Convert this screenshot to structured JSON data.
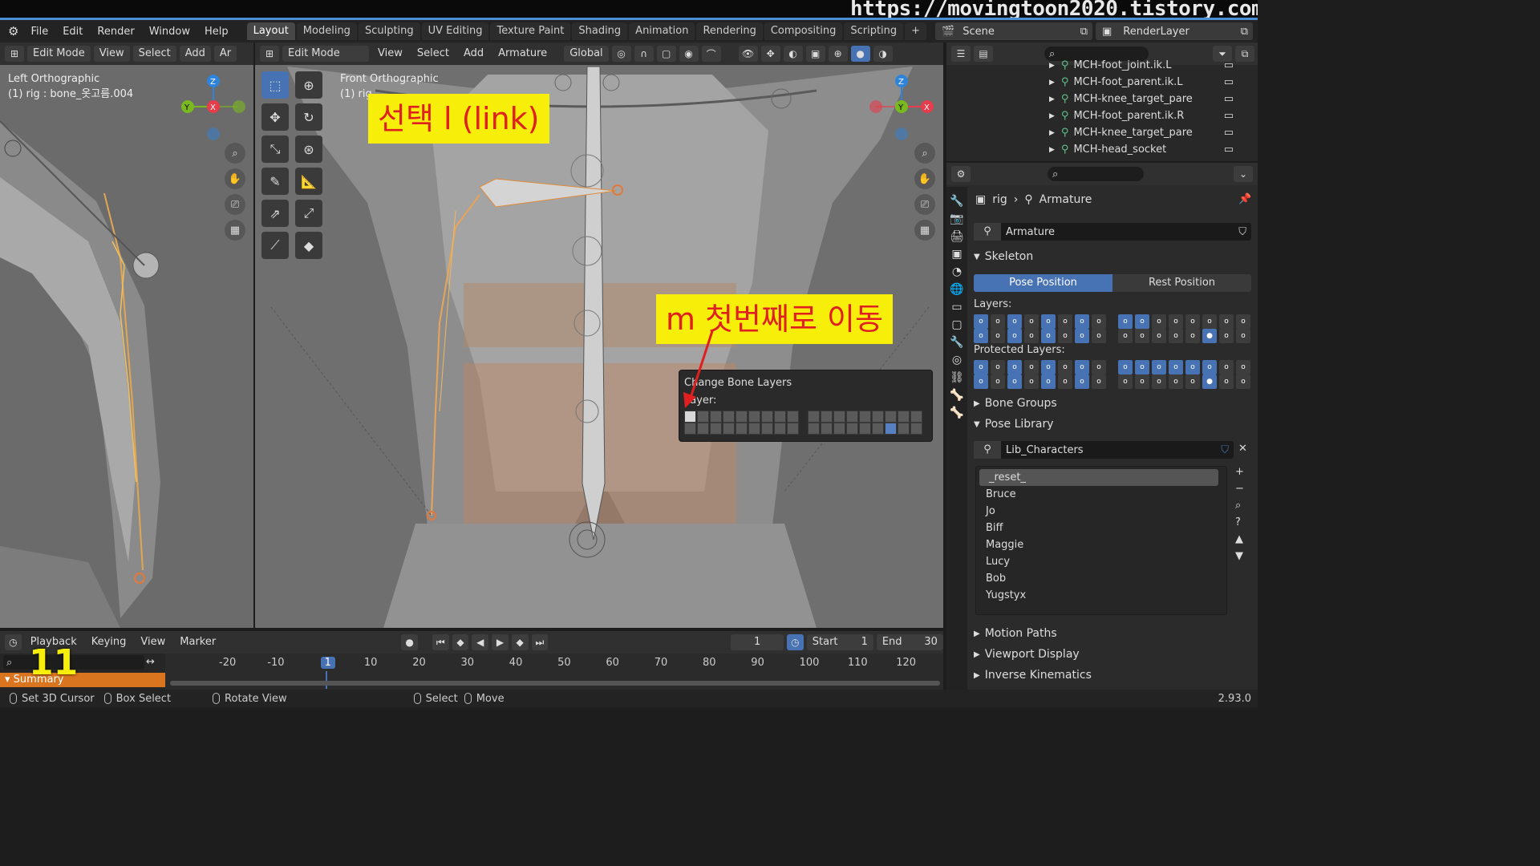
{
  "watermark": "https://movingtoon2020.tistory.com",
  "menu": [
    "File",
    "Edit",
    "Render",
    "Window",
    "Help"
  ],
  "workspaces": [
    {
      "label": "Layout",
      "active": true
    },
    {
      "label": "Modeling"
    },
    {
      "label": "Sculpting"
    },
    {
      "label": "UV Editing"
    },
    {
      "label": "Texture Paint"
    },
    {
      "label": "Shading"
    },
    {
      "label": "Animation"
    },
    {
      "label": "Rendering"
    },
    {
      "label": "Compositing"
    },
    {
      "label": "Scripting"
    }
  ],
  "add_workspace": "+",
  "scene": {
    "label": "Scene",
    "layer": "RenderLayer"
  },
  "left_vp": {
    "mode": "Edit Mode",
    "view": "View",
    "select": "Select",
    "add": "Add",
    "more": "Ar",
    "title": "Left Orthographic",
    "subtitle": "(1) rig : bone_옷고름.004"
  },
  "main_vp": {
    "mode": "Edit Mode",
    "view": "View",
    "select": "Select",
    "add": "Add",
    "armature": "Armature",
    "orientation": "Global",
    "title": "Front Orthographic",
    "subtitle": "(1) rig"
  },
  "axes": {
    "x": "X",
    "y": "Y",
    "z": "Z"
  },
  "annotations": {
    "select_link": "선택 l (link)",
    "move_first": "m 첫번째로 이동"
  },
  "popup": {
    "title": "Change Bone Layers",
    "layer": "Layer:"
  },
  "outliner": {
    "items": [
      "MCH-foot_joint.ik.L",
      "MCH-foot_parent.ik.L",
      "MCH-knee_target_pare",
      "MCH-foot_parent.ik.R",
      "MCH-knee_target_pare",
      "MCH-head_socket"
    ]
  },
  "properties": {
    "breadcrumb": [
      "rig",
      "Armature"
    ],
    "data_name": "Armature",
    "skeleton": "Skeleton",
    "pose_position": "Pose Position",
    "rest_position": "Rest Position",
    "layers": "Layers:",
    "protected_layers": "Protected Layers:",
    "bone_groups": "Bone Groups",
    "pose_library": "Pose Library",
    "library_name": "Lib_Characters",
    "poses": [
      "_reset_",
      "Bruce",
      "Jo",
      "Biff",
      "Maggie",
      "Lucy",
      "Bob",
      "Yugstyx"
    ],
    "motion_paths": "Motion Paths",
    "viewport_display": "Viewport Display",
    "inverse_kinematics": "Inverse Kinematics"
  },
  "timeline": {
    "playback": "Playback",
    "keying": "Keying",
    "view": "View",
    "marker": "Marker",
    "current_frame": "1",
    "start_label": "Start",
    "start": "1",
    "end_label": "End",
    "end": "30",
    "ticks": [
      "-20",
      "-10",
      "1",
      "10",
      "20",
      "30",
      "40",
      "50",
      "60",
      "70",
      "80",
      "90",
      "100",
      "110",
      "120"
    ],
    "summary": "Summary",
    "overlay_number": "11"
  },
  "status": {
    "set_cursor": "Set 3D Cursor",
    "box_select": "Box Select",
    "rotate_view": "Rotate View",
    "select": "Select",
    "move": "Move",
    "version": "2.93.0"
  },
  "colors": {
    "accent": "#4772b3",
    "annotation_bg": "#f7ee0a",
    "annotation_text": "#e02020",
    "x_axis": "#e63c4c",
    "y_axis": "#7ab820",
    "z_axis": "#2f83d8"
  }
}
